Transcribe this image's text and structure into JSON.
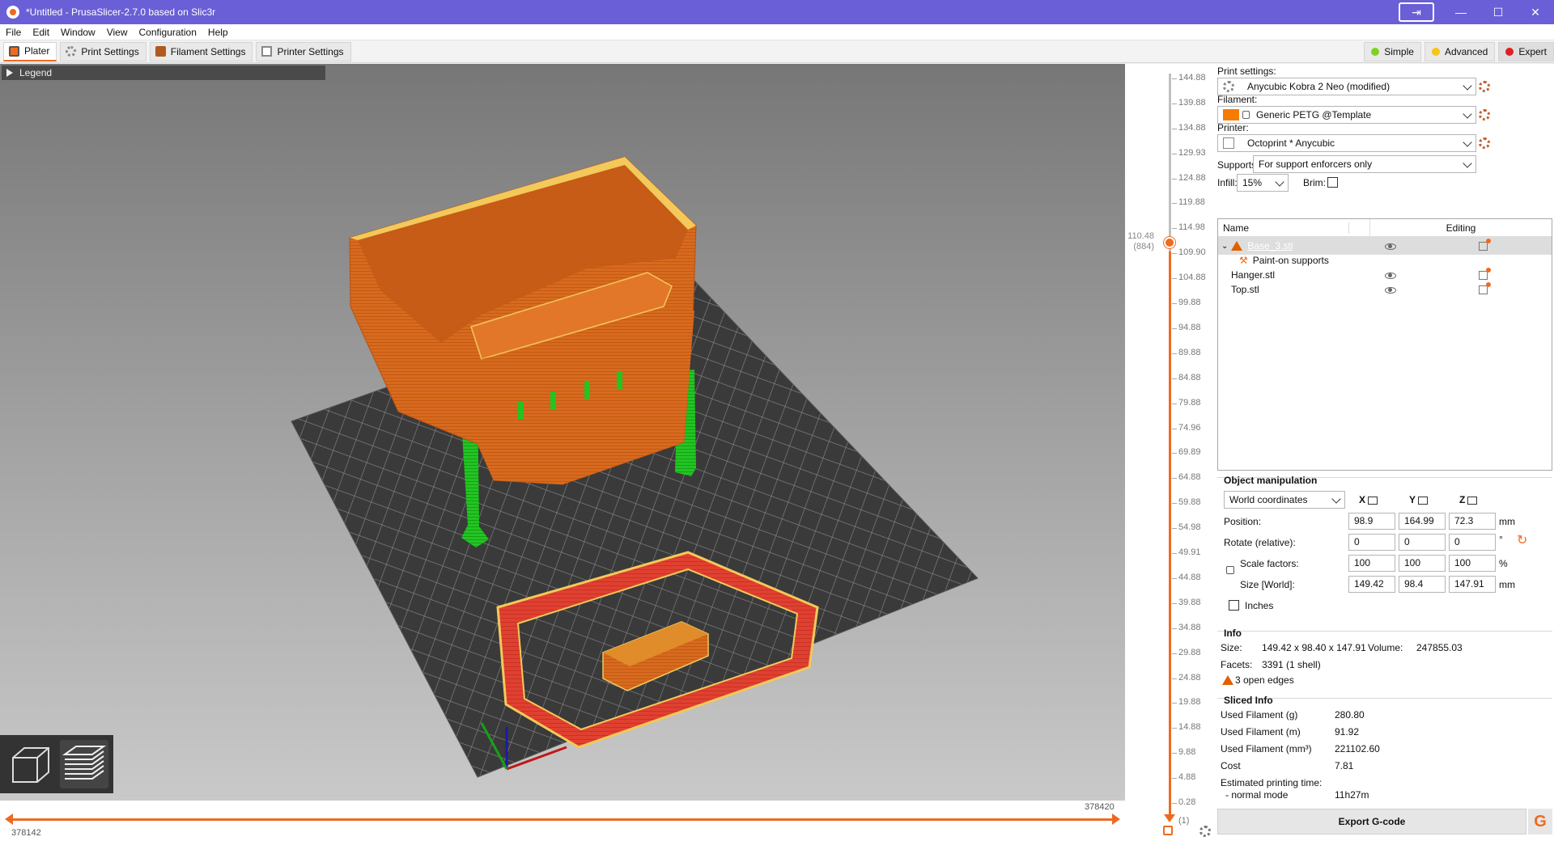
{
  "window": {
    "title": "*Untitled - PrusaSlicer-2.7.0 based on Slic3r"
  },
  "menu": [
    "File",
    "Edit",
    "Window",
    "View",
    "Configuration",
    "Help"
  ],
  "tabs": [
    "Plater",
    "Print Settings",
    "Filament Settings",
    "Printer Settings"
  ],
  "modes": [
    {
      "label": "Simple",
      "color": "#7ed321"
    },
    {
      "label": "Advanced",
      "color": "#f5c518"
    },
    {
      "label": "Expert",
      "color": "#e02020"
    }
  ],
  "viewport": {
    "legend_label": "Legend",
    "hslider": {
      "right_value": "378420",
      "left_value": "378142"
    }
  },
  "vslider": {
    "current_height": "110.48",
    "current_layer": "(884)",
    "ticks": [
      "144.88",
      "139.88",
      "134.88",
      "129.93",
      "124.88",
      "119.88",
      "114.98",
      "109.90",
      "104.88",
      "99.88",
      "94.88",
      "89.88",
      "84.88",
      "79.88",
      "74.96",
      "69.89",
      "64.88",
      "59.88",
      "54.98",
      "49.91",
      "44.88",
      "39.88",
      "34.88",
      "29.88",
      "24.88",
      "19.88",
      "14.88",
      "9.88",
      "4.88",
      "0.28"
    ],
    "bottom_layer": "(1)"
  },
  "sidebar": {
    "print_settings_label": "Print settings:",
    "print_settings_value": "Anycubic Kobra 2 Neo (modified)",
    "filament_label": "Filament:",
    "filament_value": "Generic PETG @Template",
    "filament_color": "#f57c00",
    "printer_label": "Printer:",
    "printer_value": "Octoprint * Anycubic",
    "supports_label": "Supports:",
    "supports_value": "For support enforcers only",
    "infill_label": "Infill:",
    "infill_value": "15%",
    "brim_label": "Brim:"
  },
  "object_list": {
    "col_name": "Name",
    "col_editing": "Editing",
    "items": [
      {
        "name": "Base_3.stl"
      },
      {
        "name": "Paint-on supports"
      },
      {
        "name": "Hanger.stl"
      },
      {
        "name": "Top.stl"
      }
    ]
  },
  "object_manipulation": {
    "title": "Object manipulation",
    "coords": "World coordinates",
    "axis_x": "X",
    "axis_y": "Y",
    "axis_z": "Z",
    "position_label": "Position:",
    "position": [
      "98.9",
      "164.99",
      "72.3"
    ],
    "position_unit": "mm",
    "rotate_label": "Rotate (relative):",
    "rotate": [
      "0",
      "0",
      "0"
    ],
    "rotate_unit": "°",
    "scale_label": "Scale factors:",
    "scale": [
      "100",
      "100",
      "100"
    ],
    "scale_unit": "%",
    "size_label": "Size [World]:",
    "size": [
      "149.42",
      "98.4",
      "147.91"
    ],
    "size_unit": "mm",
    "inches_label": "Inches"
  },
  "info": {
    "title": "Info",
    "size_label": "Size:",
    "size_value": "149.42 x 98.40 x 147.91",
    "volume_label": "Volume:",
    "volume_value": "247855.03",
    "facets_label": "Facets:",
    "facets_value": "3391 (1 shell)",
    "warning": "3 open edges"
  },
  "sliced_info": {
    "title": "Sliced Info",
    "rows": [
      {
        "label": "Used Filament (g)",
        "value": "280.80"
      },
      {
        "label": "Used Filament (m)",
        "value": "91.92"
      },
      {
        "label": "Used Filament (mm³)",
        "value": "221102.60"
      },
      {
        "label": "Cost",
        "value": "7.81"
      }
    ],
    "time_label": "Estimated printing time:",
    "mode_label": "- normal mode",
    "mode_value": "11h27m"
  },
  "export_label": "Export G-code"
}
